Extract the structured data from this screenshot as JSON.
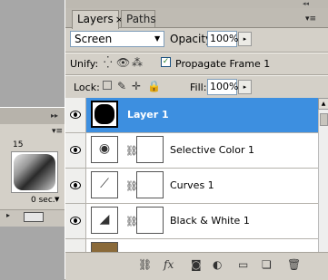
{
  "animation_panel": {
    "frame_number": "15",
    "frame_delay": "0 sec.",
    "delay_arrow": "▼"
  },
  "layers_panel": {
    "tabs": [
      {
        "label": "Layers",
        "close": "×"
      },
      {
        "label": "Paths"
      }
    ],
    "blend_mode": "Screen",
    "opacity_label": "Opacity:",
    "opacity_value": "100%",
    "unify_label": "Unify:",
    "propagate_label": "Propagate Frame 1",
    "propagate_checked": "✓",
    "lock_label": "Lock:",
    "fill_label": "Fill:",
    "fill_value": "100%",
    "layers": [
      {
        "name": "Layer 1",
        "selected": true
      },
      {
        "name": "Selective Color 1"
      },
      {
        "name": "Curves 1"
      },
      {
        "name": "Black & White 1"
      }
    ],
    "selected_color": "#3d8fe0"
  }
}
